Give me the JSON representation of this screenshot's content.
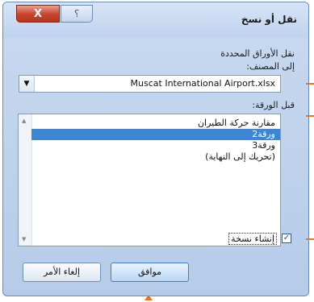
{
  "dialog": {
    "title": "نقل أو نسخ",
    "close_label": "X",
    "help_label": "؟"
  },
  "move_selected_label": "نقل الأوراق المحددة",
  "to_book_label": "إلى المصنف:",
  "to_book_value": "Muscat International Airport.xlsx",
  "before_sheet_label": "قبل الورقة:",
  "sheets": [
    "مقارنة حركة الطيران",
    "ورقة2",
    "ورقة3",
    "(تحريك إلى النهاية)"
  ],
  "selected_index": 1,
  "create_copy_label": "إنشاء نسخة",
  "create_copy_checked": true,
  "ok_label": "موافق",
  "cancel_label": "إلغاء الأمر",
  "accent_color": "#e8742a"
}
